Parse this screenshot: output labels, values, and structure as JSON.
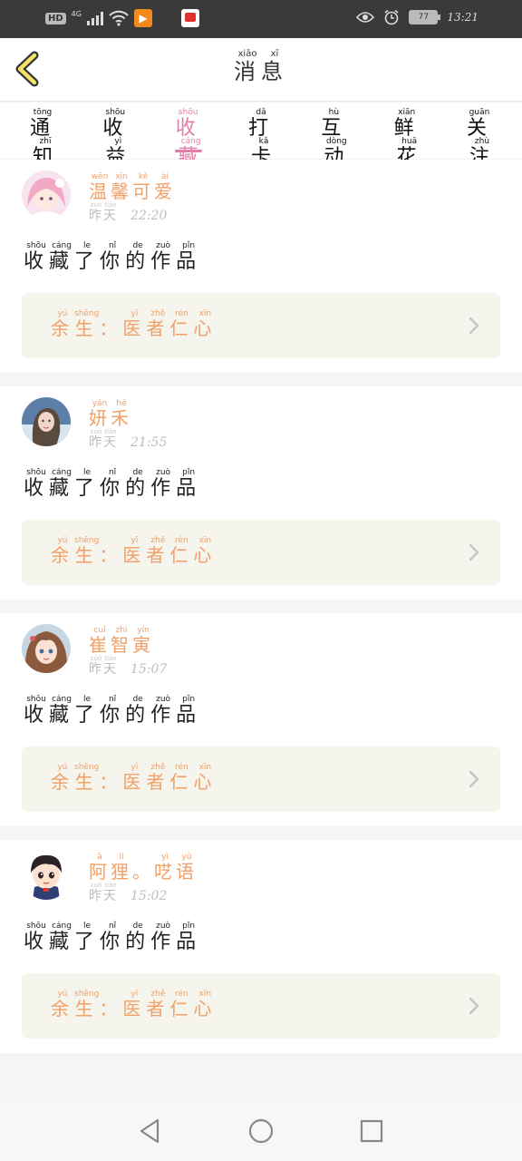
{
  "status_bar": {
    "hd": "HD",
    "network": "4G",
    "battery": "77",
    "time": "13:21"
  },
  "header": {
    "title": [
      {
        "c": "消",
        "p": "xiāo"
      },
      {
        "c": "息",
        "p": "xī"
      }
    ],
    "back_icon": "chevron-left-icon"
  },
  "tabs": [
    {
      "label": [
        {
          "c": "通",
          "p": "tōng"
        },
        {
          "c": "知",
          "p": "zhī"
        }
      ],
      "active": false
    },
    {
      "label": [
        {
          "c": "收",
          "p": "shōu"
        },
        {
          "c": "益",
          "p": "yì"
        }
      ],
      "active": false
    },
    {
      "label": [
        {
          "c": "收",
          "p": "shōu"
        },
        {
          "c": "藏",
          "p": "cáng"
        }
      ],
      "active": true
    },
    {
      "label": [
        {
          "c": "打",
          "p": "dǎ"
        },
        {
          "c": "卡",
          "p": "kǎ"
        }
      ],
      "active": false
    },
    {
      "label": [
        {
          "c": "互",
          "p": "hù"
        },
        {
          "c": "动",
          "p": "dòng"
        }
      ],
      "active": false
    },
    {
      "label": [
        {
          "c": "鲜",
          "p": "xiān"
        },
        {
          "c": "花",
          "p": "huā"
        }
      ],
      "active": false
    },
    {
      "label": [
        {
          "c": "关",
          "p": "guān"
        },
        {
          "c": "注",
          "p": "zhù"
        }
      ],
      "active": false
    }
  ],
  "messages": [
    {
      "user": [
        {
          "c": "温",
          "p": "wēn"
        },
        {
          "c": "馨",
          "p": "xīn"
        },
        {
          "c": "可",
          "p": "kě"
        },
        {
          "c": "爱",
          "p": "ài"
        }
      ],
      "day": [
        {
          "c": "昨",
          "p": "zuó"
        },
        {
          "c": "天",
          "p": "tiān"
        }
      ],
      "time": "22:20",
      "action": [
        {
          "c": "收",
          "p": "shōu"
        },
        {
          "c": "藏",
          "p": "cáng"
        },
        {
          "c": "了",
          "p": "le"
        },
        {
          "c": "你",
          "p": "nǐ"
        },
        {
          "c": "的",
          "p": "de"
        },
        {
          "c": "作",
          "p": "zuò"
        },
        {
          "c": "品",
          "p": "pǐn"
        }
      ],
      "work": [
        {
          "c": "余",
          "p": "yú"
        },
        {
          "c": "生",
          "p": "shēng"
        },
        {
          "c": "：",
          "p": ""
        },
        {
          "c": "医",
          "p": "yī"
        },
        {
          "c": "者",
          "p": "zhě"
        },
        {
          "c": "仁",
          "p": "rén"
        },
        {
          "c": "心",
          "p": "xīn"
        }
      ],
      "avatar": "anime-girl-pink-hair"
    },
    {
      "user": [
        {
          "c": "妍",
          "p": "yán"
        },
        {
          "c": "禾",
          "p": "hé"
        }
      ],
      "day": [
        {
          "c": "昨",
          "p": "zuó"
        },
        {
          "c": "天",
          "p": "tiān"
        }
      ],
      "time": "21:55",
      "action": [
        {
          "c": "收",
          "p": "shōu"
        },
        {
          "c": "藏",
          "p": "cáng"
        },
        {
          "c": "了",
          "p": "le"
        },
        {
          "c": "你",
          "p": "nǐ"
        },
        {
          "c": "的",
          "p": "de"
        },
        {
          "c": "作",
          "p": "zuò"
        },
        {
          "c": "品",
          "p": "pǐn"
        }
      ],
      "work": [
        {
          "c": "余",
          "p": "yú"
        },
        {
          "c": "生",
          "p": "shēng"
        },
        {
          "c": "：",
          "p": ""
        },
        {
          "c": "医",
          "p": "yī"
        },
        {
          "c": "者",
          "p": "zhě"
        },
        {
          "c": "仁",
          "p": "rén"
        },
        {
          "c": "心",
          "p": "xīn"
        }
      ],
      "avatar": "photo-girl"
    },
    {
      "user": [
        {
          "c": "崔",
          "p": "cuī"
        },
        {
          "c": "智",
          "p": "zhì"
        },
        {
          "c": "寅",
          "p": "yín"
        }
      ],
      "day": [
        {
          "c": "昨",
          "p": "zuó"
        },
        {
          "c": "天",
          "p": "tiān"
        }
      ],
      "time": "15:07",
      "action": [
        {
          "c": "收",
          "p": "shōu"
        },
        {
          "c": "藏",
          "p": "cáng"
        },
        {
          "c": "了",
          "p": "le"
        },
        {
          "c": "你",
          "p": "nǐ"
        },
        {
          "c": "的",
          "p": "de"
        },
        {
          "c": "作",
          "p": "zuò"
        },
        {
          "c": "品",
          "p": "pǐn"
        }
      ],
      "work": [
        {
          "c": "余",
          "p": "yú"
        },
        {
          "c": "生",
          "p": "shēng"
        },
        {
          "c": "：",
          "p": ""
        },
        {
          "c": "医",
          "p": "yī"
        },
        {
          "c": "者",
          "p": "zhě"
        },
        {
          "c": "仁",
          "p": "rén"
        },
        {
          "c": "心",
          "p": "xīn"
        }
      ],
      "avatar": "anime-girl-brown-hair"
    },
    {
      "user": [
        {
          "c": "阿",
          "p": "ā"
        },
        {
          "c": "狸",
          "p": "lí"
        },
        {
          "c": "。",
          "p": ""
        },
        {
          "c": "呓",
          "p": "yì"
        },
        {
          "c": "语",
          "p": "yǔ"
        }
      ],
      "day": [
        {
          "c": "昨",
          "p": "zuó"
        },
        {
          "c": "天",
          "p": "tiān"
        }
      ],
      "time": "15:02",
      "action": [
        {
          "c": "收",
          "p": "shōu"
        },
        {
          "c": "藏",
          "p": "cáng"
        },
        {
          "c": "了",
          "p": "le"
        },
        {
          "c": "你",
          "p": "nǐ"
        },
        {
          "c": "的",
          "p": "de"
        },
        {
          "c": "作",
          "p": "zuò"
        },
        {
          "c": "品",
          "p": "pǐn"
        }
      ],
      "work": [
        {
          "c": "余",
          "p": "yú"
        },
        {
          "c": "生",
          "p": "shēng"
        },
        {
          "c": "：",
          "p": ""
        },
        {
          "c": "医",
          "p": "yī"
        },
        {
          "c": "者",
          "p": "zhě"
        },
        {
          "c": "仁",
          "p": "rén"
        },
        {
          "c": "心",
          "p": "xīn"
        }
      ],
      "avatar": "cartoon-boy"
    }
  ],
  "colors": {
    "accent_pink": "#e37fa8",
    "name_orange": "#f0a068",
    "work_box_bg": "#f5f4ed"
  }
}
